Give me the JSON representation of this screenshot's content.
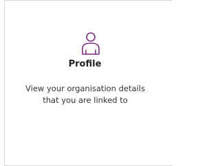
{
  "card": {
    "icon": "profile-person-icon",
    "icon_color": "#7b2c83",
    "title": "Profile",
    "description": "View your organisation details that you are linked to"
  }
}
